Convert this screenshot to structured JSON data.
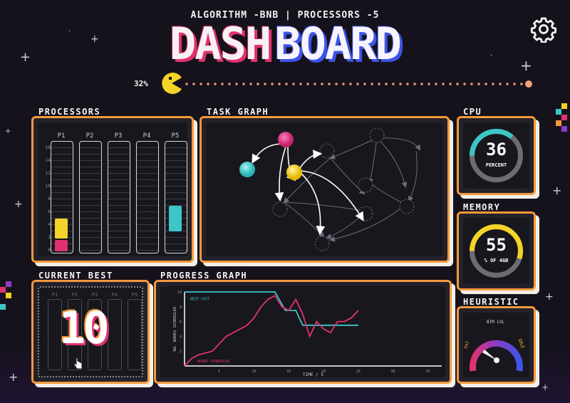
{
  "header": {
    "subtitle": "ALGORITHM -BNB | PROCESSORS -5",
    "title_part1": "DASH",
    "title_part2": "BOARD",
    "progress_percent_label": "32%",
    "progress_fraction": 0.32
  },
  "icons": {
    "settings": "gear-icon",
    "progress_marker": "pacman-icon"
  },
  "colors": {
    "accent": "#f49a3c",
    "pink": "#e0326e",
    "teal": "#3cc7c6",
    "yellow": "#f5d327",
    "blue": "#3d55e6"
  },
  "processors": {
    "label": "PROCESSORS",
    "columns": [
      "P1",
      "P2",
      "P3",
      "P4",
      "P5"
    ],
    "y_ticks": [
      "16",
      "14",
      "12",
      "10",
      "8",
      "6",
      "4",
      "2",
      "0"
    ]
  },
  "task_graph": {
    "label": "TASK GRAPH"
  },
  "cpu": {
    "label": "CPU",
    "value": "36",
    "unit": "PERCENT",
    "fraction": 0.36
  },
  "memory": {
    "label": "MEMORY",
    "value": "55",
    "unit": "% OF 4GB",
    "fraction": 0.55
  },
  "current_best": {
    "label": "CURRENT BEST",
    "value": "10",
    "columns": [
      "P1",
      "P2",
      "P3",
      "P4",
      "P5"
    ]
  },
  "progress_graph": {
    "label": "PROGRESS GRAPH"
  },
  "heuristic": {
    "label": "HEURISTIC",
    "top_label": "BTM LVL",
    "left_label": "DAT",
    "right_label": "IDLE"
  },
  "chart_data": {
    "type": "line",
    "title": "",
    "xlabel": "TIME / S",
    "ylabel": "NO. NODES SCHEDULED",
    "xlim": [
      0,
      37
    ],
    "ylim": [
      0,
      10
    ],
    "x_ticks": [
      "5",
      "10",
      "15",
      "20",
      "25",
      "30",
      "35"
    ],
    "y_ticks": [
      "10",
      "8",
      "6",
      "4",
      "2"
    ],
    "series": [
      {
        "name": "BEST COST",
        "color": "#3cc7c6",
        "x": [
          0,
          13,
          14.5,
          16,
          17,
          18.5,
          20,
          25
        ],
        "y": [
          10,
          10,
          7.5,
          7.5,
          5.5,
          5.5,
          5.5,
          5.5
        ]
      },
      {
        "name": "NODES SCHEDULED",
        "color": "#e0326e",
        "x": [
          0,
          1,
          2,
          4,
          5,
          6,
          7,
          8,
          9,
          10,
          11,
          12,
          13,
          14,
          15,
          16,
          17,
          18,
          19,
          20,
          21,
          22,
          23,
          24,
          25
        ],
        "y": [
          0,
          1,
          1.5,
          2,
          3,
          4,
          4.5,
          5,
          5.5,
          6.5,
          8,
          9,
          9.5,
          8,
          7.5,
          9,
          7,
          4,
          6,
          5,
          4.5,
          6,
          6,
          6.5,
          7.5
        ]
      }
    ]
  }
}
